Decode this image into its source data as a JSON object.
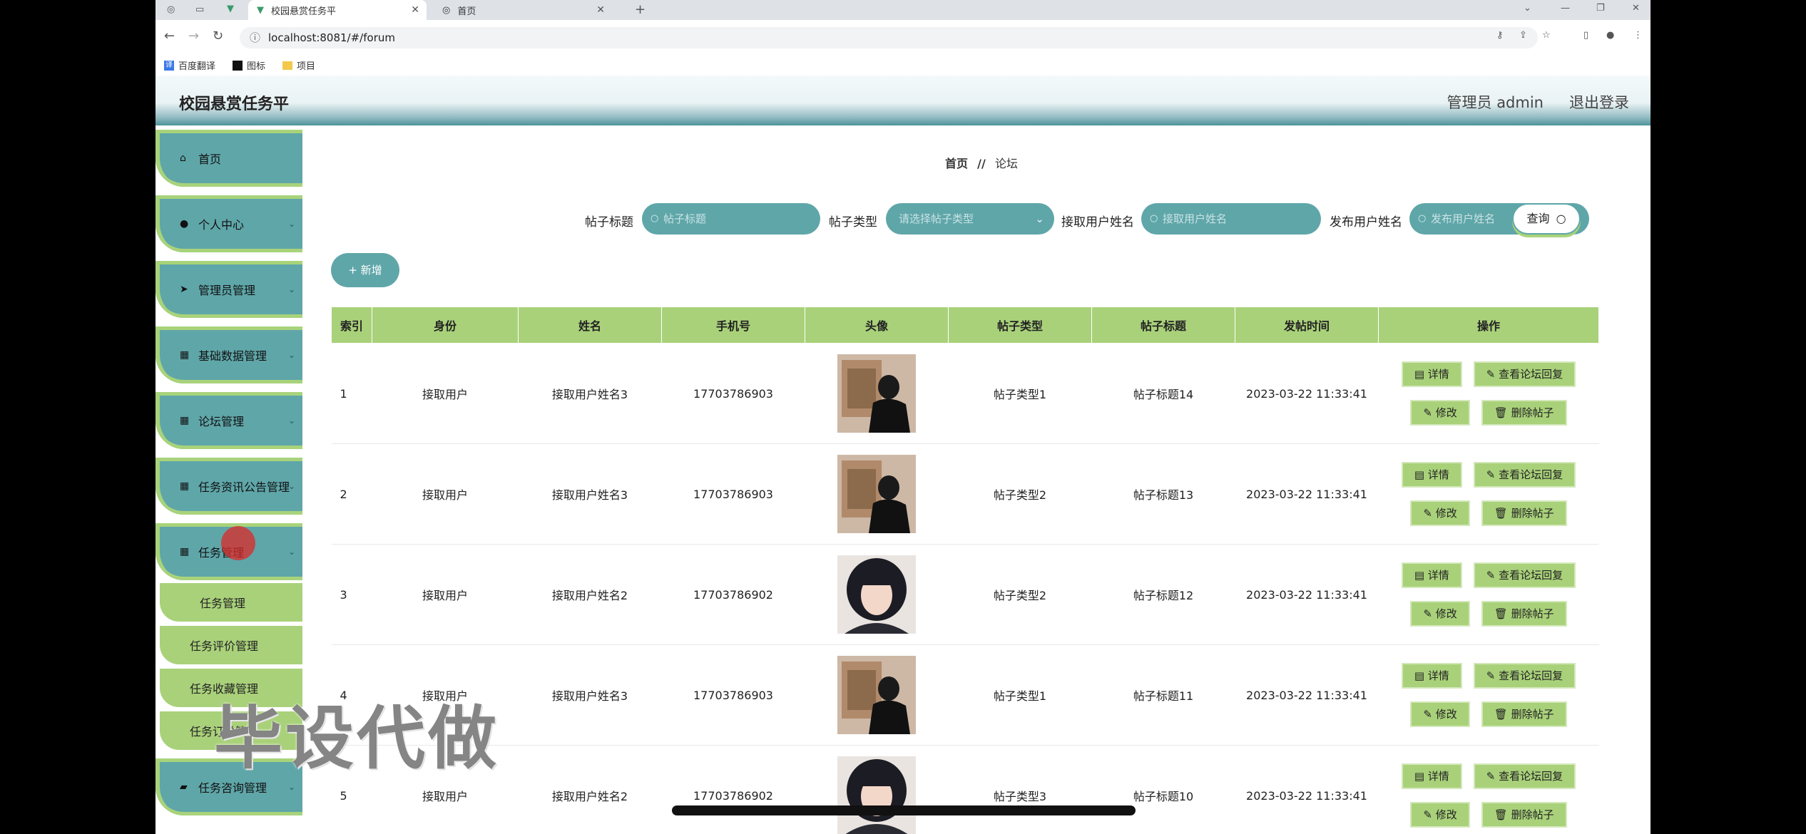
{
  "browser": {
    "tabs": [
      {
        "title": "校园悬赏任务平",
        "active": true
      },
      {
        "title": "首页",
        "active": false
      }
    ],
    "new_tab_symbol": "+",
    "url": "localhost:8081/#/forum",
    "bookmarks": [
      "百度翻译",
      "图标",
      "项目"
    ]
  },
  "header": {
    "brand": "校园悬赏任务平",
    "admin": "管理员 admin",
    "logout": "退出登录"
  },
  "sidebar": {
    "items": [
      {
        "label": "首页",
        "icon": "home-icon"
      },
      {
        "label": "个人中心",
        "icon": "user-icon"
      },
      {
        "label": "管理员管理",
        "icon": "send-icon"
      },
      {
        "label": "基础数据管理",
        "icon": "grid-icon"
      },
      {
        "label": "论坛管理",
        "icon": "grid-icon"
      },
      {
        "label": "任务资讯公告管理",
        "icon": "grid-icon"
      },
      {
        "label": "任务管理",
        "icon": "grid-icon"
      }
    ],
    "subitems": [
      "任务管理",
      "任务评价管理",
      "任务收藏管理",
      "任务订单管理"
    ],
    "bottom_item": {
      "label": "任务咨询管理",
      "icon": "chat-icon"
    }
  },
  "breadcrumb": {
    "home": "首页",
    "sep": "//",
    "current": "论坛"
  },
  "filters": {
    "title_label": "帖子标题",
    "title_placeholder": "帖子标题",
    "type_label": "帖子类型",
    "type_placeholder": "请选择帖子类型",
    "receiver_label": "接取用户姓名",
    "receiver_placeholder": "接取用户姓名",
    "publisher_label": "发布用户姓名",
    "publisher_placeholder": "发布用户姓名",
    "query_button": "查询"
  },
  "add_button": "+ 新增",
  "table": {
    "columns": [
      "索引",
      "身份",
      "姓名",
      "手机号",
      "头像",
      "帖子类型",
      "帖子标题",
      "发帖时间",
      "操作"
    ],
    "rows": [
      {
        "idx": "1",
        "role": "接取用户",
        "name": "接取用户姓名3",
        "phone": "17703786903",
        "type": "帖子类型1",
        "title": "帖子标题14",
        "time": "2023-03-22 11:33:41"
      },
      {
        "idx": "2",
        "role": "接取用户",
        "name": "接取用户姓名3",
        "phone": "17703786903",
        "type": "帖子类型2",
        "title": "帖子标题13",
        "time": "2023-03-22 11:33:41"
      },
      {
        "idx": "3",
        "role": "接取用户",
        "name": "接取用户姓名2",
        "phone": "17703786902",
        "type": "帖子类型2",
        "title": "帖子标题12",
        "time": "2023-03-22 11:33:41"
      },
      {
        "idx": "4",
        "role": "接取用户",
        "name": "接取用户姓名3",
        "phone": "17703786903",
        "type": "帖子类型1",
        "title": "帖子标题11",
        "time": "2023-03-22 11:33:41"
      },
      {
        "idx": "5",
        "role": "接取用户",
        "name": "接取用户姓名2",
        "phone": "17703786902",
        "type": "帖子类型3",
        "title": "帖子标题10",
        "time": "2023-03-22 11:33:41"
      }
    ],
    "ops": {
      "detail": "详情",
      "view_reply": "查看论坛回复",
      "edit": "修改",
      "delete": "删除帖子"
    }
  },
  "watermark": "毕设代做"
}
